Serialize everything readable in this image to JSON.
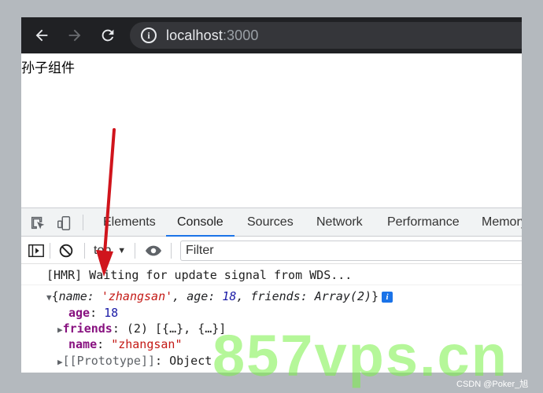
{
  "browser": {
    "url_host": "localhost",
    "url_port": ":3000"
  },
  "page": {
    "text": "孙子组件"
  },
  "devtools": {
    "tabs": [
      {
        "label": "Elements"
      },
      {
        "label": "Console"
      },
      {
        "label": "Sources"
      },
      {
        "label": "Network"
      },
      {
        "label": "Performance"
      },
      {
        "label": "Memory"
      }
    ],
    "active_tab": "Console",
    "context": "top",
    "filter_placeholder": "Filter"
  },
  "console": {
    "hmr_message": "[HMR] Waiting for update signal from WDS...",
    "object_summary": {
      "open": "{",
      "name_key": "name",
      "name_val": "'zhangsan'",
      "age_key": "age",
      "age_val": "18",
      "friends_key": "friends",
      "friends_val": "Array(2)",
      "close": "}"
    },
    "props": {
      "age_key": "age",
      "age_val": "18",
      "friends_key": "friends",
      "friends_val": "(2) [{…}, {…}]",
      "name_key": "name",
      "name_val": "\"zhangsan\"",
      "proto_key": "[[Prototype]]",
      "proto_val": "Object"
    }
  },
  "watermark": {
    "text": "857vps.cn",
    "credit": "CSDN @Poker_旭"
  },
  "colors": {
    "annotation_arrow": "#d0141c",
    "watermark": "#7cf046",
    "active_tab_underline": "#1a73e8"
  }
}
